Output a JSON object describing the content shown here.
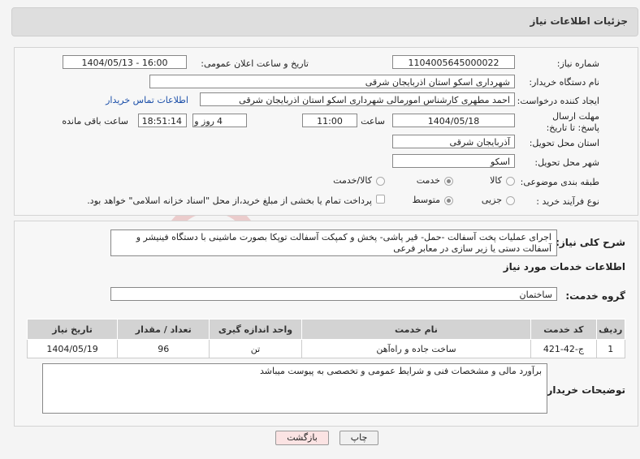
{
  "header": {
    "title": "جزئیات اطلاعات نیاز"
  },
  "form": {
    "need_number_label": "شماره نیاز:",
    "need_number": "1104005645000022",
    "announce_label": "تاریخ و ساعت اعلان عمومی:",
    "announce_value": "1404/05/13 - 16:00",
    "buyer_label": "نام دستگاه خریدار:",
    "buyer_value": "شهرداری اسکو استان اذربایجان شرقی",
    "creator_label": "ایجاد کننده درخواست:",
    "creator_value": "احمد مطهری کارشناس امورمالی شهرداری اسکو استان اذربایجان شرقی",
    "contact_link": "اطلاعات تماس خریدار",
    "deadline_label": "مهلت ارسال پاسخ: تا تاریخ:",
    "deadline_date": "1404/05/18",
    "time_label": "ساعت",
    "deadline_time": "11:00",
    "days_value": "4",
    "days_label": "روز و",
    "remaining_time": "18:51:14",
    "remaining_label": "ساعت باقی مانده",
    "province_label": "استان محل تحویل:",
    "province_value": "آذربایجان شرقی",
    "city_label": "شهر محل تحویل:",
    "city_value": "اسکو",
    "category_label": "طبقه بندی موضوعی:",
    "category_options": [
      "کالا",
      "خدمت",
      "کالا/خدمت"
    ],
    "process_label": "نوع فرآیند خرید :",
    "process_options": [
      "جزیی",
      "متوسط"
    ],
    "payment_note": "پرداخت تمام یا بخشی از مبلغ خرید،از محل \"اسناد خزانه اسلامی\" خواهد بود."
  },
  "details": {
    "summary_label": "شرح کلی نیاز:",
    "summary_text": "اجرای عملیات پخت آسفالت -حمل- قیر پاشی- پخش و کمپکت آسفالت توپکا بصورت ماشینی با دستگاه فینیشر و آسفالت دستی یا زیر سازی در معابر فرعی",
    "services_heading": "اطلاعات خدمات مورد نیاز",
    "service_group_label": "گروه خدمت:",
    "service_group_value": "ساختمان",
    "table": {
      "headers": [
        "ردیف",
        "کد خدمت",
        "نام خدمت",
        "واحد اندازه گیری",
        "تعداد / مقدار",
        "تاریخ نیاز"
      ],
      "rows": [
        [
          "1",
          "ج-42-421",
          "ساخت جاده و راه‌آهن",
          "تن",
          "96",
          "1404/05/19"
        ]
      ]
    },
    "buyer_notes_label": "توضیحات خریدار:",
    "buyer_notes_text": "برآورد مالی و مشخصات فنی و شرایط عمومی و تخصصی به پیوست میباشد"
  },
  "buttons": {
    "print": "چاپ",
    "back": "بازگشت"
  },
  "colors": {
    "link": "#1a4ea8",
    "back_button_bg": "#fbe3e3",
    "header_bg": "#dedede"
  }
}
